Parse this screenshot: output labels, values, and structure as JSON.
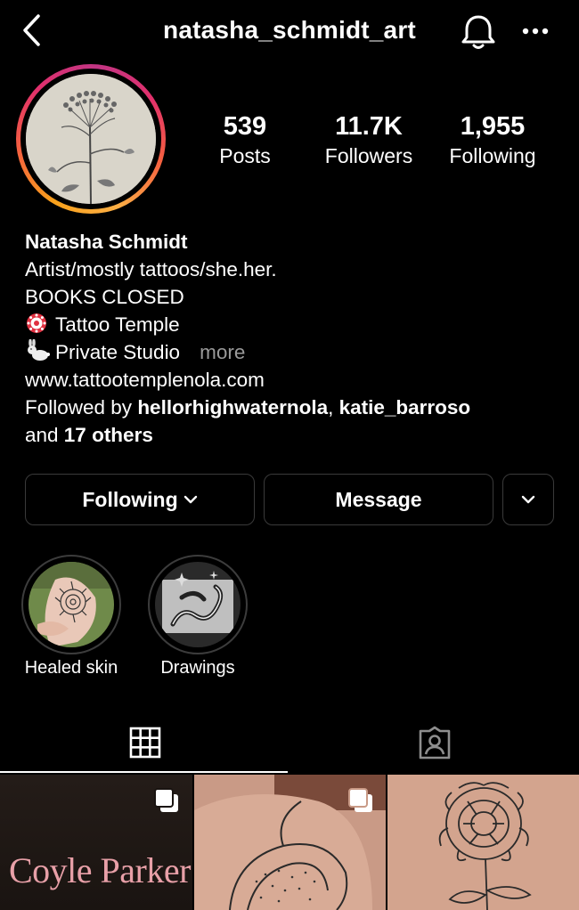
{
  "header": {
    "username": "natasha_schmidt_art",
    "back_icon": "chevron-left-icon",
    "bell_icon": "bell-icon",
    "more_icon": "ellipsis-icon"
  },
  "stats": [
    {
      "value": "539",
      "label": "Posts"
    },
    {
      "value": "11.7K",
      "label": "Followers"
    },
    {
      "value": "1,955",
      "label": "Following"
    }
  ],
  "bio": {
    "name": "Natasha Schmidt",
    "line1": "Artist/mostly tattoos/she.her.",
    "line2": "BOOKS CLOSED",
    "line3": "Tattoo Temple",
    "line4": "Private Studio",
    "more": "more",
    "link": "www.tattootemplenola.com",
    "followed_prefix": "Followed by ",
    "followed_user1": "hellorhighwaternola",
    "followed_sep": ", ",
    "followed_user2": "katie_barroso",
    "followed_and": "and ",
    "followed_others": "17 others"
  },
  "actions": {
    "following_label": "Following",
    "message_label": "Message"
  },
  "highlights": [
    {
      "label": "Healed skin"
    },
    {
      "label": "Drawings"
    }
  ],
  "tabs": {
    "grid_icon": "grid-icon",
    "tagged_icon": "tagged-person-icon"
  },
  "grid": {
    "post1_text": "Coyle Parker"
  },
  "colors": {
    "background": "#000000",
    "text": "#ffffff",
    "muted": "#9a9a9a",
    "button_border": "#3a3a3a",
    "post1_text": "#e8a0a8"
  }
}
